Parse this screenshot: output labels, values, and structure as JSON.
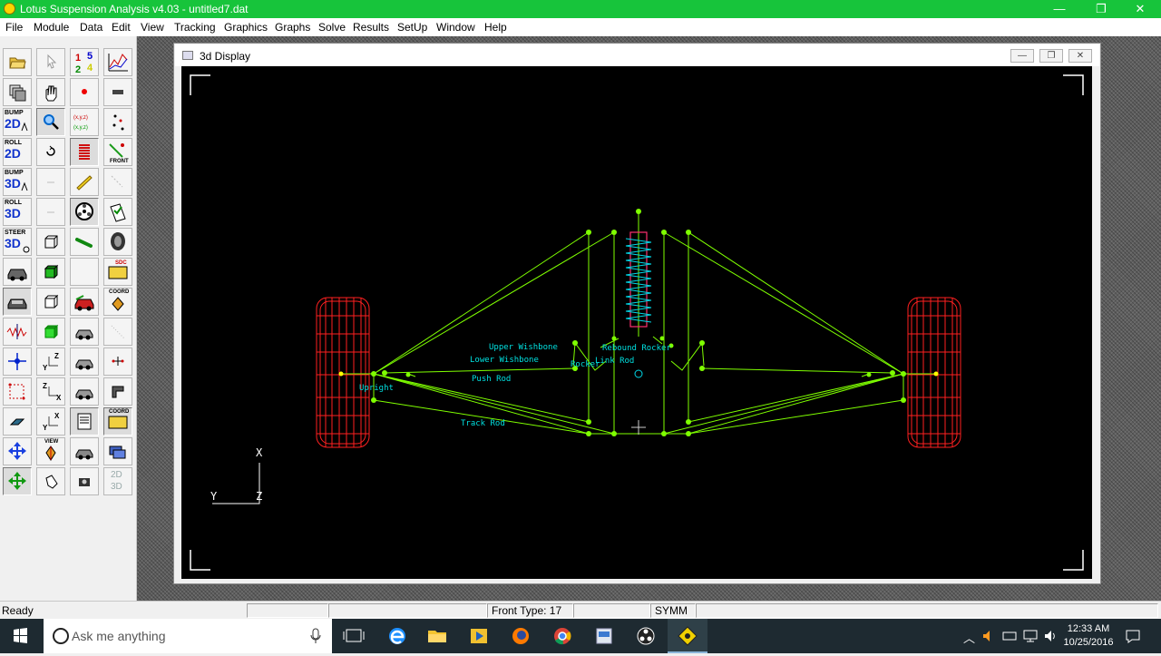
{
  "window": {
    "title": "Lotus Suspension Analysis v4.03 - untitled7.dat",
    "minimize_glyph": "—",
    "maximize_glyph": "❐",
    "close_glyph": "✕"
  },
  "menu": [
    "File",
    "Module",
    "Data",
    "Edit",
    "View",
    "Tracking",
    "Graphics",
    "Graphs",
    "Solve",
    "Results",
    "SetUp",
    "Window",
    "Help"
  ],
  "toolbar": {
    "bump2d": {
      "top": "BUMP",
      "big": "2D"
    },
    "roll2d": {
      "top": "ROLL",
      "big": "2D"
    },
    "bump3d": {
      "top": "BUMP",
      "big": "3D"
    },
    "roll3d": {
      "top": "ROLL",
      "big": "3D"
    },
    "steer3d": {
      "top": "STEER",
      "big": "3D"
    },
    "numbers": {
      "a": "1",
      "b": "5",
      "c": "2",
      "d": "4"
    },
    "coords": {
      "a": "(x,y,z)",
      "b": "(x,y,z)"
    },
    "front": "FRONT",
    "axis_yz": {
      "a": "Y",
      "b": "Z"
    },
    "axis_zx": {
      "a": "Z",
      "b": "X"
    },
    "axis_yx": {
      "a": "Y",
      "b": "X"
    },
    "coord1": "COORD",
    "coord2": "COORD",
    "view": "VIEW",
    "sdc": "SDC",
    "two_three": {
      "a": "2D",
      "b": "3D"
    }
  },
  "display_window": {
    "title": "3d Display"
  },
  "scene": {
    "labels": {
      "upper_wishbone": "Upper Wishbone",
      "lower_wishbone": "Lower Wishbone",
      "push_rod": "Push Rod",
      "upright": "Upright",
      "track_rod": "Track Rod",
      "rocker": "Rocker",
      "link_rod": "Link Rod",
      "rebound_rocker": "Rebound Rocker"
    },
    "axis": {
      "vertical": "X",
      "horizontal_left": "Y",
      "corner": "Z"
    },
    "colors": {
      "wireframe": "#7fff00",
      "tyre": "#ff2020",
      "spring": "#00d8e8",
      "damper": "#ff3070",
      "label": "#00e0e0"
    }
  },
  "status": {
    "ready": "Ready",
    "front_type": "Front Type: 17",
    "symm": "SYMM"
  },
  "taskbar": {
    "search_placeholder": "Ask me anything",
    "time": "12:33 AM",
    "date": "10/25/2016"
  }
}
